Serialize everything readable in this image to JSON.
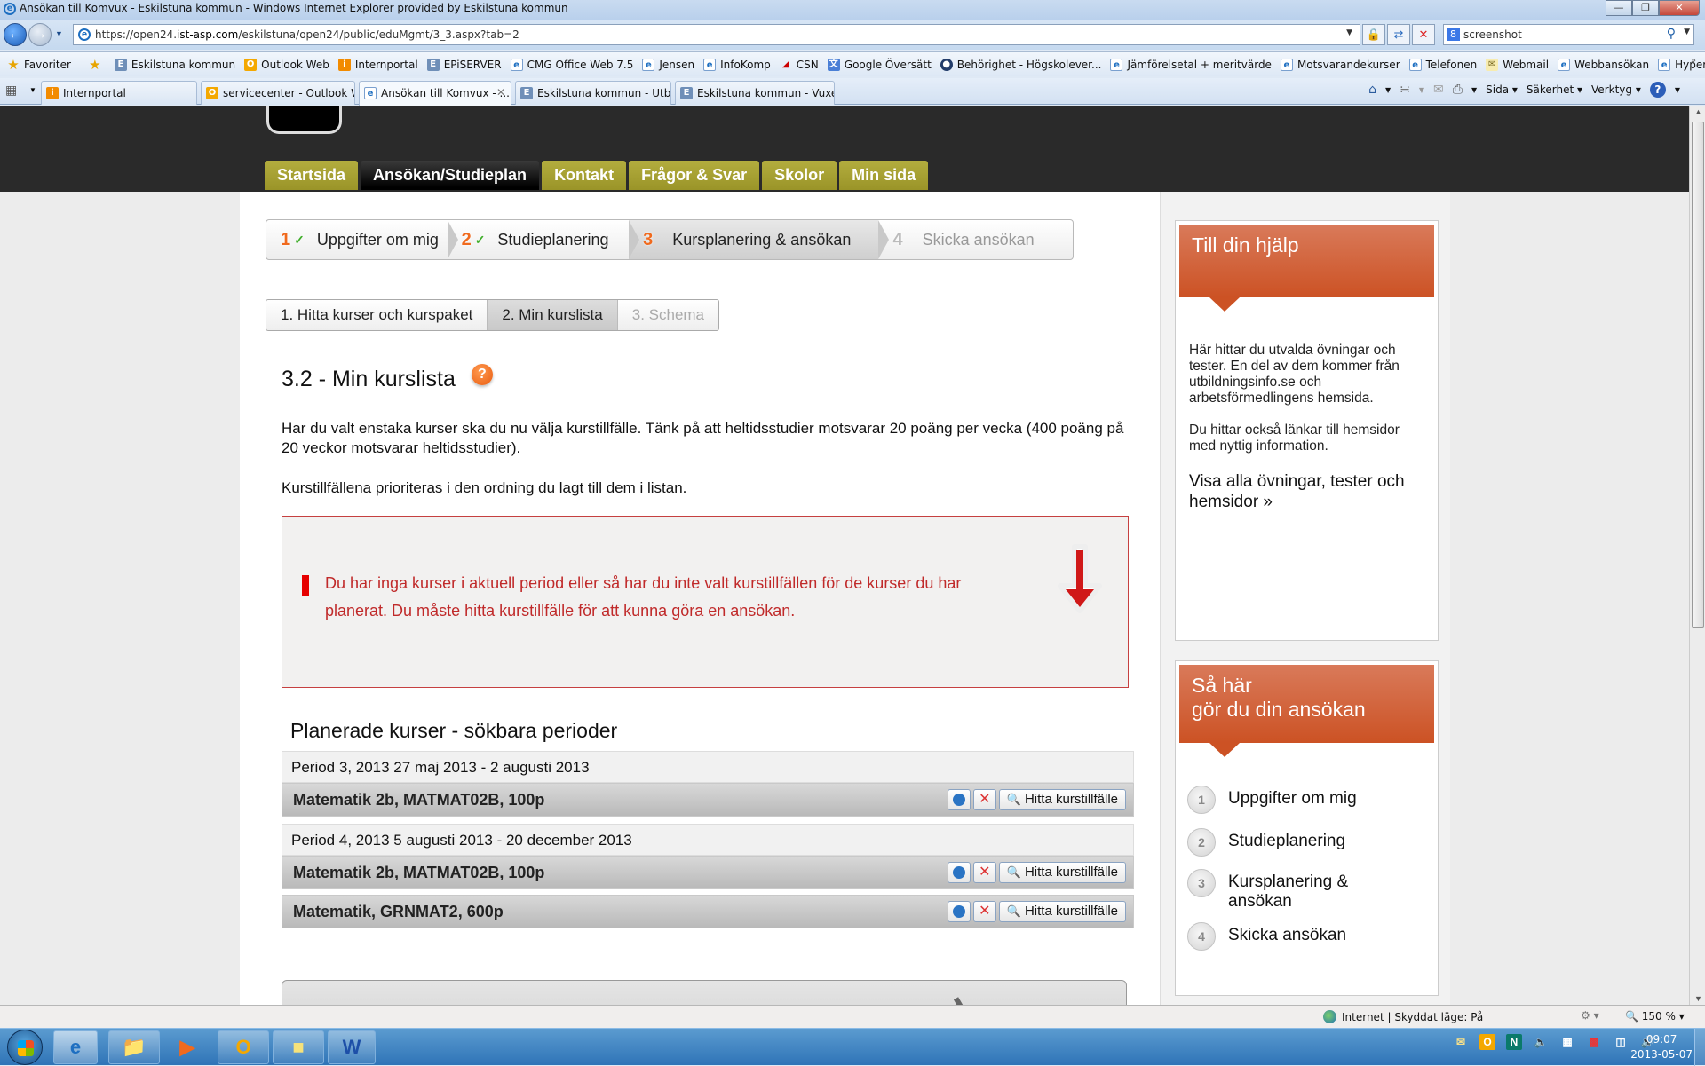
{
  "browser": {
    "window_title": "Ansökan till Komvux - Eskilstuna kommun - Windows Internet Explorer provided by Eskilstuna kommun",
    "url_prefix": "https://open24.",
    "url_domain": "ist-asp.com",
    "url_path": "/eskilstuna/open24/public/eduMgmt/3_3.aspx?tab=2",
    "search_value": "screenshot",
    "favorites_label": "Favoriter",
    "favorites": [
      {
        "label": "Eskilstuna kommun",
        "icon": "ek"
      },
      {
        "label": "Outlook Web",
        "icon": "ol"
      },
      {
        "label": "Internportal",
        "icon": "ip"
      },
      {
        "label": "EPiSERVER",
        "icon": "ek"
      },
      {
        "label": "CMG Office Web 7.5",
        "icon": "page"
      },
      {
        "label": "Jensen",
        "icon": "page"
      },
      {
        "label": "InfoKomp",
        "icon": "page"
      },
      {
        "label": "CSN",
        "icon": "csn"
      },
      {
        "label": "Google Översätt",
        "icon": "gt"
      },
      {
        "label": "Behörighet - Högskolever...",
        "icon": "beh"
      },
      {
        "label": "Jämförelsetal + meritvärde",
        "icon": "page"
      },
      {
        "label": "Motsvarandekurser",
        "icon": "page"
      },
      {
        "label": "Telefonen",
        "icon": "page"
      },
      {
        "label": "Webmail",
        "icon": "mail"
      },
      {
        "label": "Webbansökan",
        "icon": "page"
      },
      {
        "label": "Hypernet adm",
        "icon": "page"
      }
    ],
    "tabs": [
      {
        "label": "Internportal",
        "icon": "ip",
        "active": false
      },
      {
        "label": "servicecenter - Outlook W...",
        "icon": "ol",
        "active": false
      },
      {
        "label": "Ansökan till Komvux - ...",
        "icon": "page",
        "active": true
      },
      {
        "label": "Eskilstuna kommun - Utbil...",
        "icon": "ek",
        "active": false
      },
      {
        "label": "Eskilstuna kommun - Vuxe...",
        "icon": "ek",
        "active": false
      }
    ],
    "command_bar": {
      "page": "Sida",
      "safety": "Säkerhet",
      "tools": "Verktyg"
    },
    "status": {
      "zone": "Internet | Skyddat läge: På",
      "zoom": "150 %"
    }
  },
  "site": {
    "main_nav": [
      {
        "label": "Startsida",
        "active": false
      },
      {
        "label": "Ansökan/Studieplan",
        "active": true
      },
      {
        "label": "Kontakt",
        "active": false
      },
      {
        "label": "Frågor & Svar",
        "active": false
      },
      {
        "label": "Skolor",
        "active": false
      },
      {
        "label": "Min sida",
        "active": false
      }
    ],
    "stepper": [
      {
        "num": "1",
        "label": "Uppgifter om mig",
        "state": "done"
      },
      {
        "num": "2",
        "label": "Studieplanering",
        "state": "done"
      },
      {
        "num": "3",
        "label": "Kursplanering & ansökan",
        "state": "current"
      },
      {
        "num": "4",
        "label": "Skicka ansökan",
        "state": "future"
      }
    ],
    "subtabs": [
      {
        "label": "1. Hitta kurser och kurspaket",
        "state": "normal"
      },
      {
        "label": "2. Min kurslista",
        "state": "active"
      },
      {
        "label": "3. Schema",
        "state": "disabled"
      }
    ],
    "heading": "3.2 - Min kurslista",
    "intro": "Har du valt enstaka kurser ska du nu välja kurstillfälle. Tänk på att heltidsstudier motsvarar 20 poäng per vecka (400 poäng på 20 veckor motsvarar heltidsstudier).",
    "priority_note": "Kurstillfällena prioriteras i den ordning du lagt till dem i listan.",
    "alert": "Du har inga kurser i aktuell period eller så har du inte valt kurstillfällen för de kurser du har planerat. Du måste hitta kurstillfälle för att kunna göra en ansökan.",
    "planned_title": "Planerade kurser - sökbara perioder",
    "find_label": "Hitta kurstillfälle",
    "periods": [
      {
        "label": "Period 3, 2013   27 maj 2013 - 2 augusti 2013",
        "courses": [
          "Matematik 2b, MATMAT02B, 100p"
        ]
      },
      {
        "label": "Period 4, 2013   5 augusti 2013 - 20 december 2013",
        "courses": [
          "Matematik 2b, MATMAT02B, 100p",
          "Matematik, GRNMAT2, 600p"
        ]
      }
    ],
    "help_panel": {
      "title": "Till din hjälp",
      "body1": "Här hittar du utvalda övningar och tester. En del av dem kommer från utbildningsinfo.se och arbetsförmedlingens hemsida.",
      "body2": "Du hittar också länkar till hemsidor med nyttig information.",
      "link": "Visa alla övningar, tester och hemsidor »"
    },
    "howto_panel": {
      "title_line1": "Så här",
      "title_line2": "gör du din ansökan",
      "steps": [
        {
          "num": "1",
          "label": "Uppgifter om mig"
        },
        {
          "num": "2",
          "label": "Studieplanering"
        },
        {
          "num": "3",
          "label": "Kursplanering & ansökan"
        },
        {
          "num": "4",
          "label": "Skicka ansökan"
        }
      ]
    }
  },
  "taskbar": {
    "clock_time": "09:07",
    "clock_date": "2013-05-07"
  },
  "colors": {
    "nav_olive": "#a8a232",
    "panel_orange": "#cc5224",
    "alert_red": "#c02a2a",
    "step_orange": "#f06a1e"
  }
}
